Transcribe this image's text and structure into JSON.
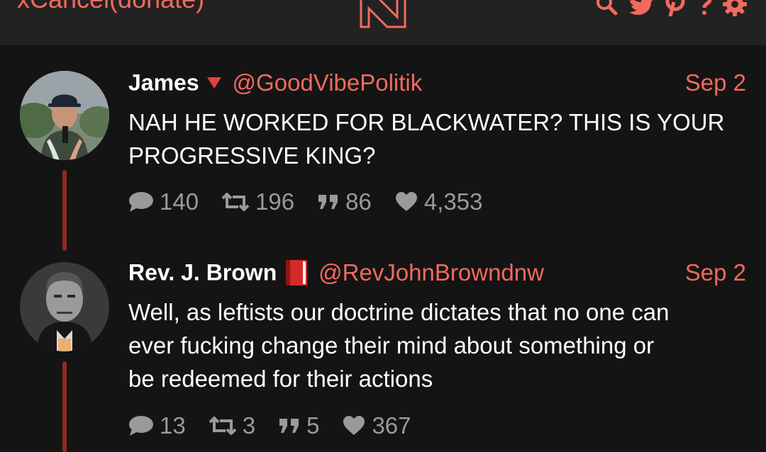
{
  "header": {
    "link_text": "xCancel(donate)",
    "logo_letter": "N",
    "icons": [
      "search-icon",
      "twitter-icon",
      "pinterest-icon",
      "help-icon",
      "gear-icon"
    ]
  },
  "colors": {
    "accent": "#f26a5d",
    "thread_line": "#8c2a24",
    "background": "#141414",
    "header_bg": "#222222",
    "muted": "#9a9a9a"
  },
  "tweets": [
    {
      "name": "James",
      "flair": "red-triangle-down-icon",
      "handle": "@GoodVibePolitik",
      "date": "Sep 2",
      "text_lines": [
        "NAH HE WORKED FOR BLACKWATER? THIS IS YOUR",
        "PROGRESSIVE KING?"
      ],
      "stats": {
        "replies": "140",
        "retweets": "196",
        "quotes": "86",
        "likes": "4,353"
      }
    },
    {
      "name": "Rev. J. Brown",
      "flair": "red-book-icon",
      "handle": "@RevJohnBrowndnw",
      "date": "Sep 2",
      "text_lines": [
        "Well, as leftists our doctrine dictates that no one can",
        "ever fucking change their mind about something or",
        "be redeemed for their actions"
      ],
      "stats": {
        "replies": "13",
        "retweets": "3",
        "quotes": "5",
        "likes": "367"
      }
    }
  ]
}
